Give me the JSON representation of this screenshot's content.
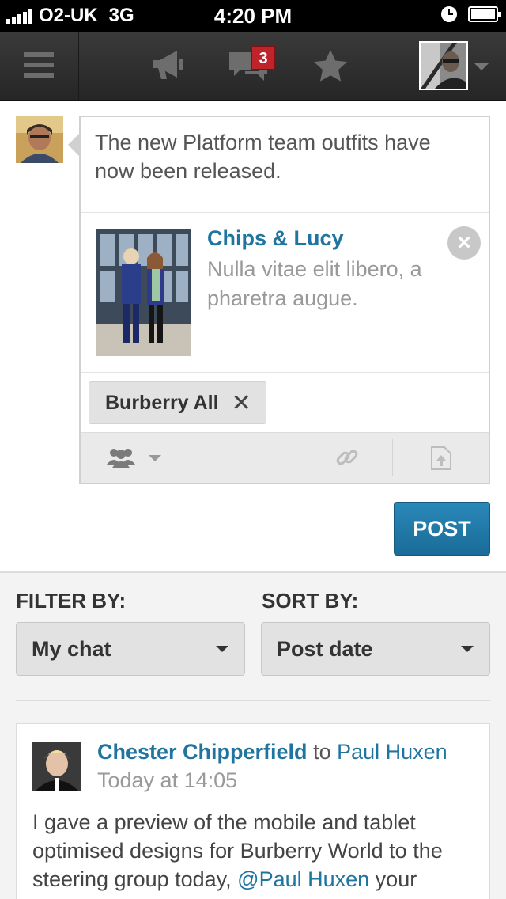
{
  "status_bar": {
    "carrier": "O2-UK",
    "network": "3G",
    "time": "4:20 PM"
  },
  "nav": {
    "chat_badge_count": "3",
    "icons": [
      "menu-icon",
      "megaphone-icon",
      "chat-icon",
      "star-icon",
      "user-avatar",
      "chevron-down-icon"
    ]
  },
  "composer": {
    "text": "The new Platform team outfits have now been released.",
    "attachment": {
      "title": "Chips & Lucy",
      "description": "Nulla vitae elit libero, a pharetra augue."
    },
    "tag": {
      "label": "Burberry All",
      "remove_glyph": "✕"
    },
    "post_label": "POST"
  },
  "filter": {
    "filter_label": "FILTER BY:",
    "filter_value": "My chat",
    "sort_label": "SORT BY:",
    "sort_value": "Post date"
  },
  "feed": {
    "post": {
      "author": "Chester Chipperfield",
      "to_word": "to",
      "recipient": "Paul Huxen",
      "time": "Today at 14:05",
      "body_before": "I gave a preview of the mobile and tablet optimised designs for Burberry World to the steering group today, ",
      "mention": "@Paul Huxen",
      "body_after": " your"
    }
  },
  "colors": {
    "accent_blue": "#1f74a0",
    "badge_red": "#c0242b",
    "navbar_dark": "#2e2e2e"
  }
}
